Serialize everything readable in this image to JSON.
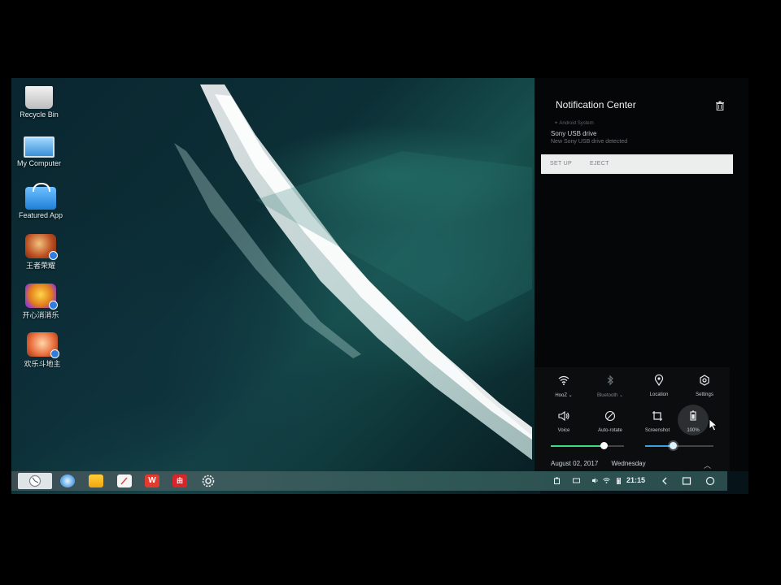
{
  "desktop": {
    "icons": [
      {
        "label": "Recycle Bin",
        "icon": "recycle-bin-icon"
      },
      {
        "label": "My Computer",
        "icon": "computer-icon"
      },
      {
        "label": "Featured App",
        "icon": "app-store-icon"
      },
      {
        "label": "王者荣耀",
        "icon": "game-icon"
      },
      {
        "label": "开心消消乐",
        "icon": "game-icon"
      },
      {
        "label": "欢乐斗地主",
        "icon": "game-icon"
      }
    ]
  },
  "notification_center": {
    "title": "Notification Center",
    "notification": {
      "source": "Android System",
      "title": "Sony USB drive",
      "text": "New Sony USB drive detected",
      "actions": [
        "SET UP",
        "EJECT"
      ]
    },
    "quick_settings": [
      {
        "label": "HooZ",
        "icon": "wifi-icon",
        "active": true
      },
      {
        "label": "Bluetooth",
        "icon": "bluetooth-icon",
        "active": false
      },
      {
        "label": "Location",
        "icon": "location-icon",
        "active": true
      },
      {
        "label": "Settings",
        "icon": "gear-icon",
        "active": true
      },
      {
        "label": "Voice",
        "icon": "speaker-icon",
        "active": true
      },
      {
        "label": "Auto-rotate",
        "icon": "rotate-icon",
        "active": true
      },
      {
        "label": "Screenshot",
        "icon": "crop-icon",
        "active": true
      },
      {
        "label": "100%",
        "icon": "battery-icon",
        "active": true
      }
    ],
    "volume_level": 0.72,
    "brightness_level": 0.4,
    "date": "August 02, 2017",
    "weekday": "Wednesday",
    "colors": {
      "volume": "#3ddc84",
      "brightness": "#3aa0e0"
    }
  },
  "taskbar": {
    "apps": [
      "start-icon",
      "browser-icon",
      "folder-icon",
      "document-icon",
      "wps-icon",
      "media-icon",
      "settings-icon"
    ],
    "clock": "21:15"
  }
}
